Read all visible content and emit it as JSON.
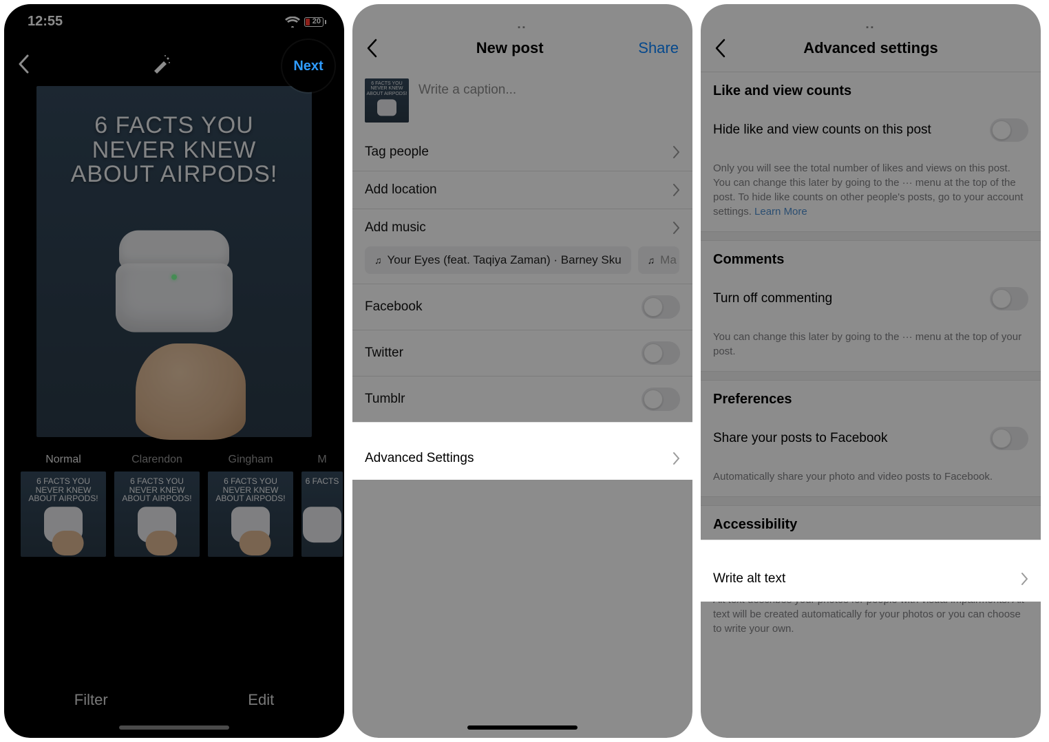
{
  "phone1": {
    "status": {
      "time": "12:55",
      "battery": "20"
    },
    "header": {
      "next_label": "Next"
    },
    "preview": {
      "headline": "6 FACTS YOU NEVER KNEW ABOUT AIRPODS!"
    },
    "filters": [
      {
        "label": "Normal",
        "thumb_text": "6 FACTS YOU NEVER KNEW ABOUT AIRPODS!"
      },
      {
        "label": "Clarendon",
        "thumb_text": "6 FACTS YOU NEVER KNEW ABOUT AIRPODS!"
      },
      {
        "label": "Gingham",
        "thumb_text": "6 FACTS YOU NEVER KNEW ABOUT AIRPODS!"
      },
      {
        "label": "M",
        "thumb_text": "6 FACTS"
      }
    ],
    "tabs": {
      "filter": "Filter",
      "edit": "Edit"
    }
  },
  "phone2": {
    "header": {
      "title": "New post",
      "share": "Share"
    },
    "caption_placeholder": "Write a caption...",
    "rows": {
      "tag_people": "Tag people",
      "add_location": "Add location",
      "add_music": "Add music",
      "music_chip1": "Your Eyes (feat. Taqiya Zaman) · Barney Sku",
      "music_chip2": "Ma",
      "facebook": "Facebook",
      "twitter": "Twitter",
      "tumblr": "Tumblr",
      "advanced_settings": "Advanced Settings"
    }
  },
  "phone3": {
    "header": {
      "title": "Advanced settings"
    },
    "sections": {
      "like_view_header": "Like and view counts",
      "hide_counts": "Hide like and view counts on this post",
      "hide_counts_desc": "Only you will see the total number of likes and views on this post. You can change this later by going to the ··· menu at the top of the post. To hide like counts on other people's posts, go to your account settings. ",
      "learn_more": "Learn More",
      "comments_header": "Comments",
      "turn_off_commenting": "Turn off commenting",
      "comments_desc": "You can change this later by going to the ··· menu at the top of your post.",
      "preferences_header": "Preferences",
      "share_facebook": "Share your posts to Facebook",
      "share_facebook_desc": "Automatically share your photo and video posts to Facebook.",
      "accessibility_header": "Accessibility",
      "write_alt_text": "Write alt text",
      "alt_desc": "Alt text describes your photos for people with visual impairments. Alt text will be created automatically for your photos or you can choose to write your own."
    }
  }
}
